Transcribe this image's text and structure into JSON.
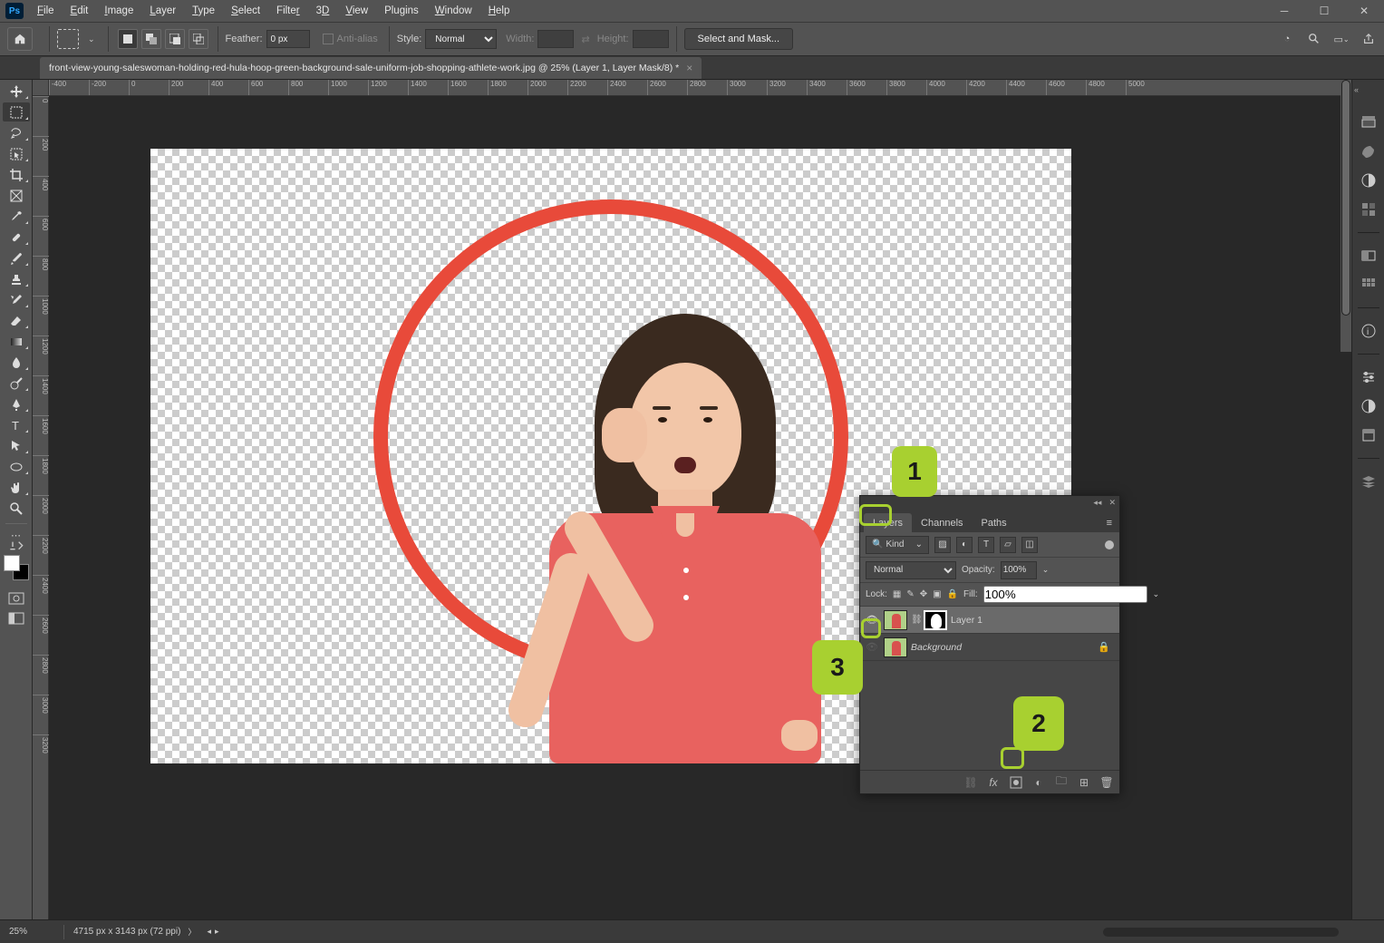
{
  "menubar": {
    "items": [
      "File",
      "Edit",
      "Image",
      "Layer",
      "Type",
      "Select",
      "Filter",
      "3D",
      "View",
      "Plugins",
      "Window",
      "Help"
    ]
  },
  "options": {
    "feather_label": "Feather:",
    "feather_value": "0 px",
    "antialias_label": "Anti-alias",
    "style_label": "Style:",
    "style_value": "Normal",
    "width_label": "Width:",
    "height_label": "Height:",
    "select_mask": "Select and Mask..."
  },
  "doc_tab": "front-view-young-saleswoman-holding-red-hula-hoop-green-background-sale-uniform-job-shopping-athlete-work.jpg @ 25% (Layer 1, Layer Mask/8) *",
  "ruler_h": [
    "-400",
    "-200",
    "0",
    "200",
    "400",
    "600",
    "800",
    "1000",
    "1200",
    "1400",
    "1600",
    "1800",
    "2000",
    "2200",
    "2400",
    "2600",
    "2800",
    "3000",
    "3200",
    "3400",
    "3600",
    "3800",
    "4000",
    "4200",
    "4400",
    "4600",
    "4800",
    "5000"
  ],
  "ruler_v": [
    "0",
    "200",
    "400",
    "600",
    "800",
    "1000",
    "1200",
    "1400",
    "1600",
    "1800",
    "2000",
    "2200",
    "2400",
    "2600",
    "2800",
    "3000",
    "3200"
  ],
  "layers_panel": {
    "tabs": [
      "Layers",
      "Channels",
      "Paths"
    ],
    "kind_label": "Kind",
    "blend_mode": "Normal",
    "opacity_label": "Opacity:",
    "opacity_value": "100%",
    "lock_label": "Lock:",
    "fill_label": "Fill:",
    "fill_value": "100%",
    "rows": [
      {
        "name": "Layer 1",
        "visible": true,
        "mask": true,
        "selected": true
      },
      {
        "name": "Background",
        "visible": false,
        "locked": true,
        "italic": true
      }
    ]
  },
  "callouts": {
    "one": "1",
    "two": "2",
    "three": "3"
  },
  "status": {
    "zoom": "25%",
    "dims": "4715 px x 3143 px (72 ppi)"
  }
}
